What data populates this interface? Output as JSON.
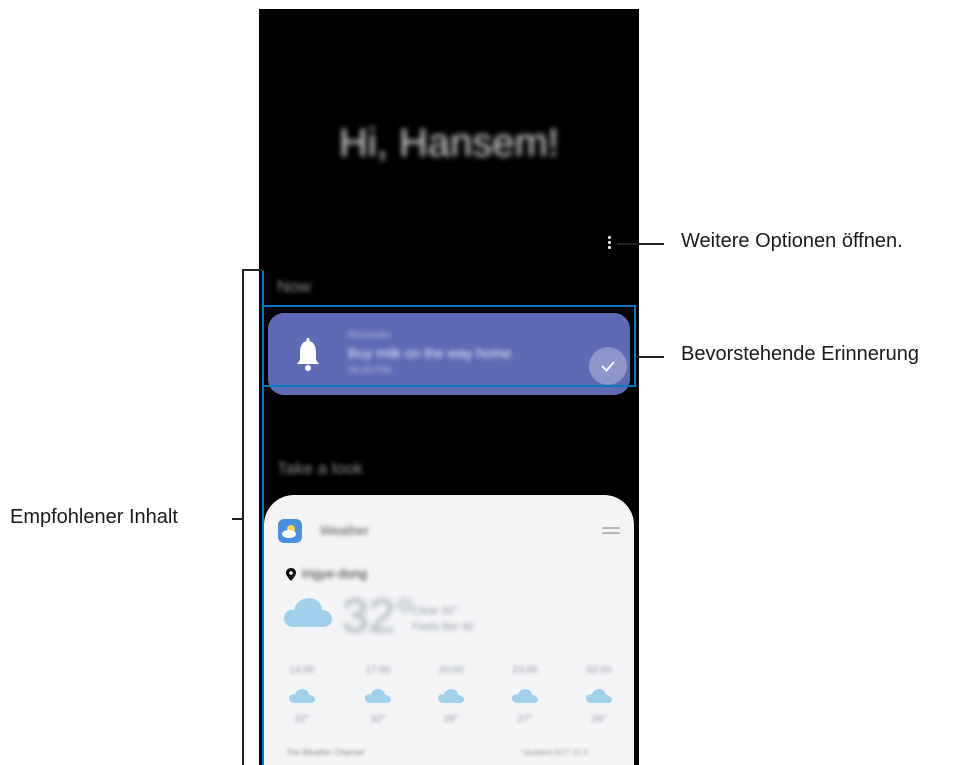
{
  "screen": {
    "greeting": "Hi, Hansem!",
    "section_now": "Now",
    "reminder": {
      "category": "Reminder",
      "title": "Buy milk on the way home",
      "time": "06:00 PM"
    },
    "section_look": "Take a look",
    "weather_card": {
      "app_name": "Weather",
      "location": "Irigye-dong",
      "temperature": "32°",
      "detail_1": "Clear 32°",
      "detail_2": "Feels like 40",
      "hourly": [
        {
          "time": "14:00",
          "temp": "32°"
        },
        {
          "time": "17:00",
          "temp": "32°"
        },
        {
          "time": "20:00",
          "temp": "28°"
        },
        {
          "time": "23:00",
          "temp": "27°"
        },
        {
          "time": "02:00",
          "temp": "26°"
        }
      ],
      "provider": "The Weather Channel",
      "updated": "Updated 8/27 21:3"
    }
  },
  "callouts": {
    "more_options": "Weitere Optionen öffnen.",
    "upcoming_reminder": "Bevorstehende Erinnerung",
    "recommended_content": "Empfohlener Inhalt"
  },
  "colors": {
    "reminder_card": "#5e6ab3",
    "highlight_border": "#0a77c2",
    "weather_icon": "#4a90e2",
    "cloud": "#9fd0ec"
  },
  "icons": [
    "more-options-icon",
    "bell-icon",
    "check-icon",
    "weather-app-icon",
    "drag-handle-icon",
    "location-pin-icon",
    "cloud-icon"
  ]
}
